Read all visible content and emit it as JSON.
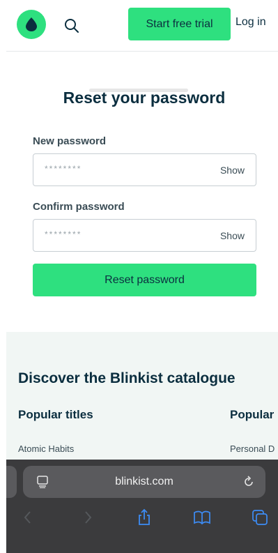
{
  "header": {
    "logo_icon": "blinkist-logo-icon",
    "search_icon": "search-icon",
    "trial_label": "Start free trial",
    "login_label": "Log in"
  },
  "form": {
    "title": "Reset your password",
    "new_password": {
      "label": "New password",
      "placeholder": "********",
      "toggle": "Show"
    },
    "confirm_password": {
      "label": "Confirm password",
      "placeholder": "********",
      "toggle": "Show"
    },
    "submit_label": "Reset password"
  },
  "catalogue": {
    "title": "Discover the Blinkist catalogue",
    "columns": [
      {
        "heading": "Popular titles",
        "first_item": "Atomic Habits"
      },
      {
        "heading": "Popular",
        "first_item": "Personal D"
      }
    ]
  },
  "browser": {
    "url": "blinkist.com",
    "icons": [
      "page-menu-icon",
      "reload-icon",
      "back-icon",
      "forward-icon",
      "share-icon",
      "bookmarks-icon",
      "tabs-icon"
    ]
  },
  "colors": {
    "brand_green": "#2ee07f",
    "text_dark": "#0b2e3f",
    "catalogue_bg": "#f1f6f4",
    "browser_bg": "#3b3b3d",
    "toolbar_icon_active": "#3d8cf5",
    "toolbar_icon_disabled": "#55585c"
  }
}
